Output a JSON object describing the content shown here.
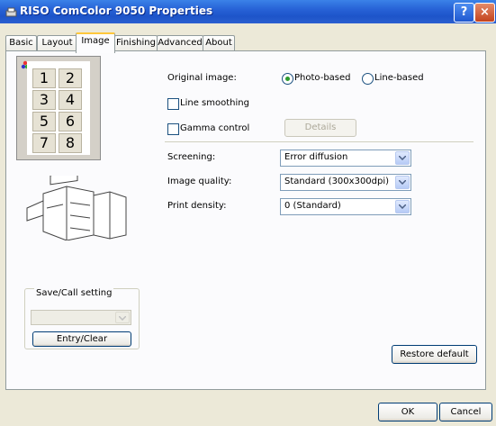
{
  "window": {
    "title": "RISO ComColor 9050 Properties",
    "help_label": "?",
    "close_label": "×"
  },
  "tabs": [
    {
      "label": "Basic"
    },
    {
      "label": "Layout"
    },
    {
      "label": "Image"
    },
    {
      "label": "Finishing"
    },
    {
      "label": "Advanced"
    },
    {
      "label": "About"
    }
  ],
  "active_tab": "Image",
  "preview": {
    "pages": [
      "1",
      "2",
      "3",
      "4",
      "5",
      "6",
      "7",
      "8"
    ]
  },
  "original_image": {
    "label": "Original image:",
    "options": [
      {
        "label": "Photo-based",
        "selected": true
      },
      {
        "label": "Line-based",
        "selected": false
      }
    ]
  },
  "line_smoothing": {
    "label": "Line smoothing",
    "checked": false
  },
  "gamma_control": {
    "label": "Gamma control",
    "checked": false,
    "details_label": "Details"
  },
  "screening": {
    "label": "Screening:",
    "value": "Error diffusion"
  },
  "image_quality": {
    "label": "Image quality:",
    "value": "Standard (300x300dpi)"
  },
  "print_density": {
    "label": "Print density:",
    "value": "0 (Standard)"
  },
  "save_call": {
    "title": "Save/Call setting",
    "value": "",
    "entry_label": "Entry/Clear"
  },
  "restore_label": "Restore default",
  "ok_label": "OK",
  "cancel_label": "Cancel",
  "colors": {
    "titlebar": "#2762d6",
    "tab_highlight": "#ffc83c",
    "window_bg": "#ece9d8"
  }
}
